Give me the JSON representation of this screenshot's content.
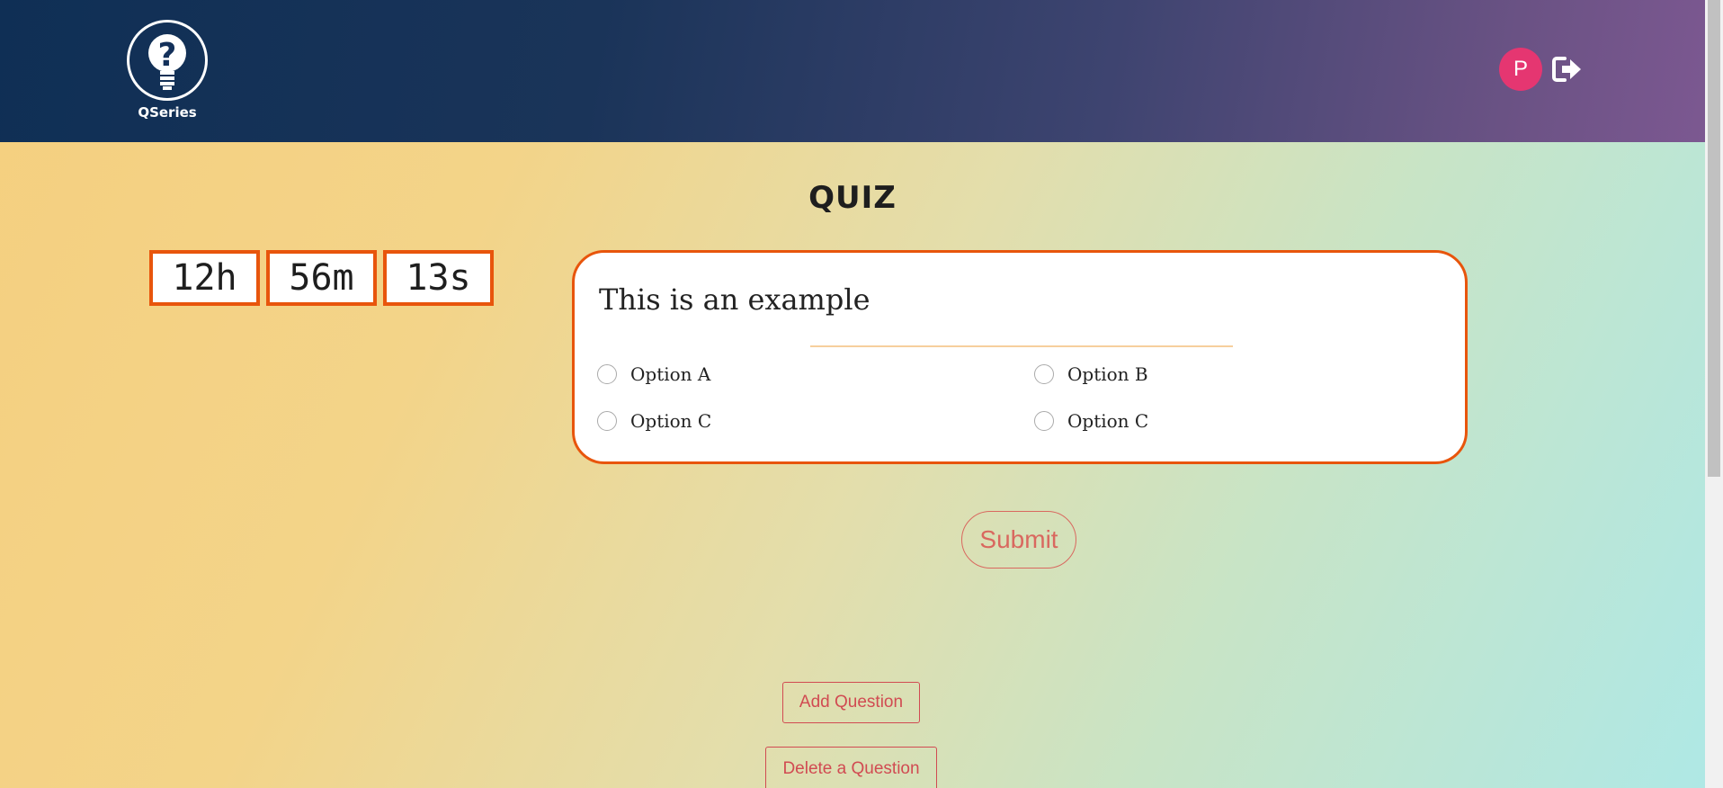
{
  "app": {
    "name": "QSeries",
    "logo_icon": "lightbulb-question-icon",
    "user_initial": "P",
    "logout_icon": "sign-out-icon",
    "colors": {
      "header_start": "#0f2f55",
      "header_end": "#7c5891",
      "accent": "#e8550c",
      "avatar": "#e53671",
      "button_text": "#d14b52"
    }
  },
  "quiz": {
    "title": "QUIZ",
    "timer": {
      "hours": "12h",
      "minutes": "56m",
      "seconds": "13s"
    },
    "question": {
      "text": "This is an example",
      "options": [
        "Option A",
        "Option B",
        "Option C",
        "Option C"
      ]
    },
    "submit_label": "Submit"
  },
  "admin": {
    "add_label": "Add Question",
    "delete_label": "Delete a Question"
  }
}
